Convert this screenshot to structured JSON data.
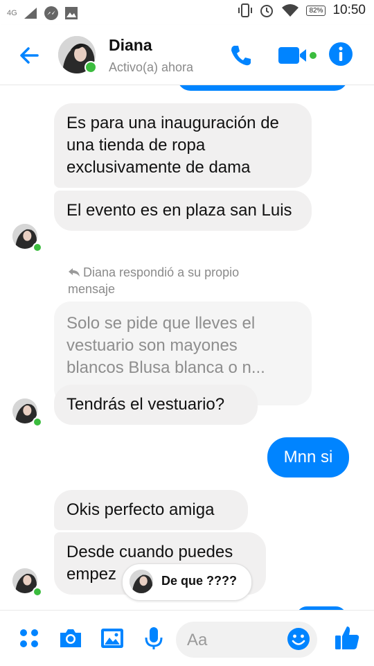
{
  "status_bar": {
    "network": "4G",
    "battery": "82%",
    "time": "10:50"
  },
  "header": {
    "name": "Diana",
    "status": "Activo(a) ahora"
  },
  "messages": {
    "m1": "Es para una inauguración de una tienda de ropa exclusivamente de dama",
    "m2": "El evento es en plaza san Luis",
    "reply_note": "Diana respondió a su propio mensaje",
    "quoted": "Solo se pide que lleves el vestuario son mayones blancos Blusa blanca o n...",
    "m3": "Tendrás el vestuario?",
    "out1": "Mnn si",
    "m4": "Okis perfecto amiga",
    "m5": "Desde cuando puedes empez",
    "typing": "De que ????"
  },
  "composer": {
    "placeholder": "Aa"
  },
  "colors": {
    "accent": "#0084ff",
    "online": "#3bbc3e",
    "bubble_in": "#f1f0f0"
  },
  "icons": [
    "back-arrow-icon",
    "phone-icon",
    "video-camera-icon",
    "info-icon",
    "menu-dots-icon",
    "camera-icon",
    "gallery-icon",
    "microphone-icon",
    "emoji-icon",
    "thumbs-up-icon"
  ]
}
